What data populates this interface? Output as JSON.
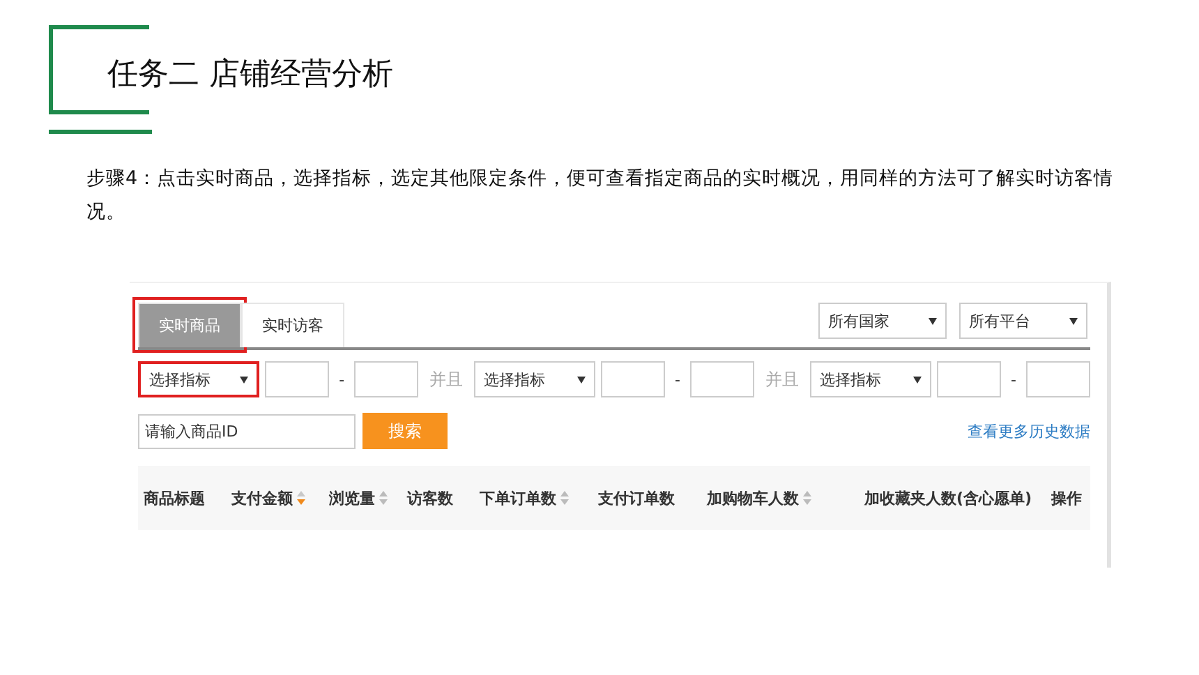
{
  "slide_title": "任务二 店铺经营分析",
  "step_text": "步骤4：点击实时商品，选择指标，选定其他限定条件，便可查看指定商品的实时概况，用同样的方法可了解实时访客情况。",
  "screenshot": {
    "tabs": [
      {
        "label": "实时商品",
        "selected": true,
        "highlighted": true
      },
      {
        "label": "实时访客",
        "selected": false,
        "highlighted": false
      }
    ],
    "dropdowns": [
      "所有国家",
      "所有平台"
    ],
    "conditions": [
      {
        "metric": "选择指标",
        "separator": "-",
        "highlighted": true
      },
      {
        "joiner": "并且",
        "metric": "选择指标",
        "separator": "-",
        "highlighted": false
      },
      {
        "joiner": "并且",
        "metric": "选择指标",
        "separator": "-",
        "highlighted": false
      }
    ],
    "search": {
      "placeholder": "请输入商品ID",
      "button": "搜索"
    },
    "history_link": "查看更多历史数据",
    "columns": [
      {
        "label": "商品标题"
      },
      {
        "label": "支付金额",
        "sortable": true,
        "sort_active": true
      },
      {
        "label": "浏览量",
        "sortable": true,
        "sort_active": false
      },
      {
        "label": "访客数"
      },
      {
        "label": "下单订单数",
        "sortable": true,
        "sort_active": false
      },
      {
        "label": "支付订单数"
      },
      {
        "label": "加购物车人数",
        "sortable": true,
        "sort_active": false
      },
      {
        "label": "加收藏夹人数(含心愿单)"
      },
      {
        "label": "操作"
      }
    ]
  }
}
